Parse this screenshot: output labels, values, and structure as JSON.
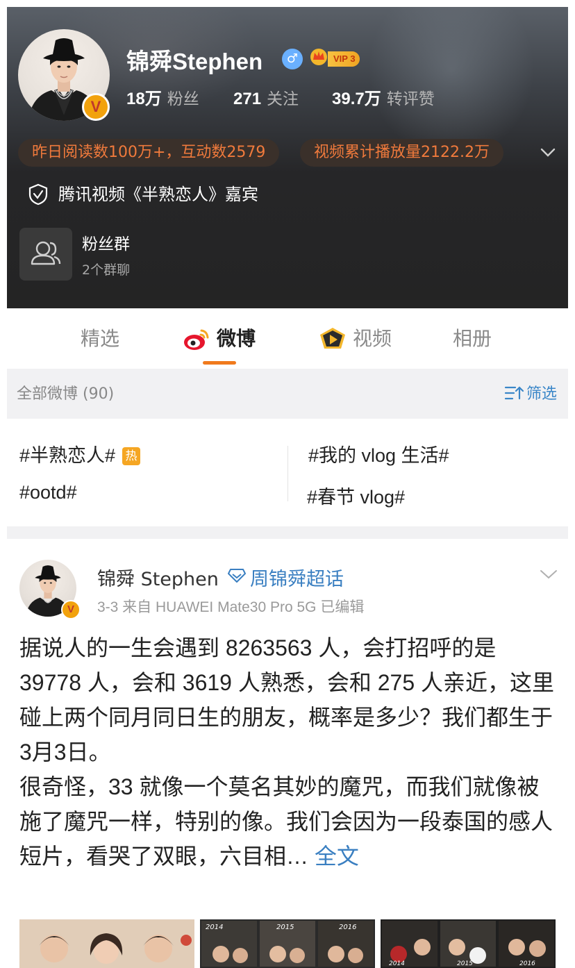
{
  "profile": {
    "name": "锦舜Stephen",
    "gender_icon": "male-icon",
    "vip_label": "VIP 3",
    "verified_label": "V",
    "stats": [
      {
        "num": "18万",
        "label": "粉丝"
      },
      {
        "num": "271",
        "label": "关注"
      },
      {
        "num": "39.7万",
        "label": "转评赞"
      }
    ],
    "pills": [
      "昨日阅读数100万+，互动数2579",
      "视频累计播放量2122.2万"
    ],
    "guest_text": "腾讯视频《半熟恋人》嘉宾",
    "fan_group": {
      "title": "粉丝群",
      "subtitle": "2个群聊"
    }
  },
  "tabs": [
    {
      "label": "精选",
      "active": false
    },
    {
      "label": "微博",
      "active": true
    },
    {
      "label": "视频",
      "active": false
    },
    {
      "label": "相册",
      "active": false
    }
  ],
  "filter": {
    "all_posts": "全部微博 (90)",
    "filter_label": "筛选"
  },
  "topics": [
    {
      "label": "#半熟恋人#",
      "badge": "热"
    },
    {
      "label": "#我的 vlog 生活#"
    },
    {
      "label": "#ootd#"
    },
    {
      "label": "#春节 vlog#"
    }
  ],
  "post": {
    "author": "锦舜 Stephen",
    "supertopic": "周锦舜超话",
    "meta": "3-3  来自 HUAWEI Mate30 Pro 5G  已编辑",
    "verified_label": "V",
    "para1": "据说人的一生会遇到 8263563 人，会打招呼的是 39778 人，会和 3619 人熟悉，会和 275 人亲近，这里碰上两个同月同日生的朋友，概率是多少？我们都生于 3月3日。",
    "para2": "很奇怪，33 就像一个莫名其妙的魔咒，而我们就像被施了魔咒一样，特别的像。我们会因为一段泰国的感人短片，看哭了双眼，六目相…",
    "full_text_link": "全文",
    "thumb_labels": [
      "2014",
      "2015",
      "2016",
      "2014",
      "2015",
      "2016"
    ]
  },
  "colors": {
    "accent": "#f07a1d",
    "link": "#3a7fc1",
    "header_bg": "#242424",
    "pill_text": "#f07a3c"
  }
}
